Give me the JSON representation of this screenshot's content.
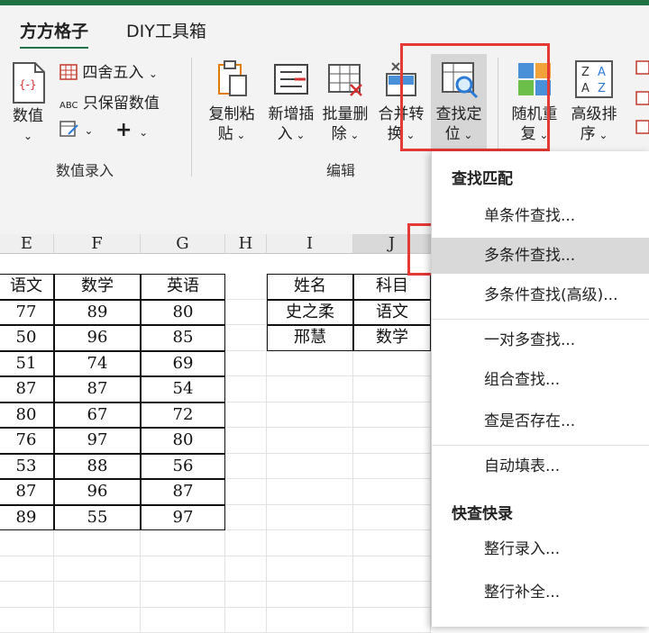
{
  "tabs": [
    {
      "label": "方方格子",
      "active": true
    },
    {
      "label": "DIY工具箱",
      "active": false
    }
  ],
  "ribbon": {
    "value_group": {
      "label": "数值录入",
      "value_button": {
        "line1": "数值",
        "line2": ""
      },
      "round_label": "四舍五入",
      "keep_label": "只保留数值",
      "abc_label": "ABC"
    },
    "edit_group": {
      "label": "编辑",
      "buttons": [
        {
          "line1": "复制粘",
          "line2": "贴"
        },
        {
          "line1": "新增插",
          "line2": "入"
        },
        {
          "line1": "批量删",
          "line2": "除"
        },
        {
          "line1": "合并转",
          "line2": "换"
        },
        {
          "line1": "查找定",
          "line2": "位"
        },
        {
          "line1": "随机重",
          "line2": "复"
        },
        {
          "line1": "高级排",
          "line2": "序"
        }
      ]
    },
    "sort_icon_letters": [
      "Z",
      "A",
      "A",
      "Z"
    ],
    "colors": {
      "accent": "#217346",
      "highlight_red": "#e53935"
    }
  },
  "sheet": {
    "col_headers": [
      "E",
      "F",
      "G",
      "H",
      "I",
      "J"
    ],
    "table_header": [
      "语文",
      "数学",
      "英语"
    ],
    "rows": [
      [
        "77",
        "89",
        "80"
      ],
      [
        "50",
        "96",
        "85"
      ],
      [
        "51",
        "74",
        "69"
      ],
      [
        "87",
        "87",
        "54"
      ],
      [
        "80",
        "67",
        "72"
      ],
      [
        "76",
        "97",
        "80"
      ],
      [
        "53",
        "88",
        "56"
      ],
      [
        "87",
        "96",
        "87"
      ],
      [
        "89",
        "55",
        "97"
      ]
    ],
    "lookup": {
      "header": [
        "姓名",
        "科目"
      ],
      "rows": [
        [
          "史之柔",
          "语文"
        ],
        [
          "邢慧",
          "数学"
        ]
      ]
    }
  },
  "menu": {
    "section1": "查找匹配",
    "items1": [
      "单条件查找...",
      "多条件查找...",
      "多条件查找(高级)...",
      "一对多查找...",
      "组合查找...",
      "查是否存在...",
      "自动填表..."
    ],
    "section2": "快查快录",
    "items2": [
      "整行录入...",
      "整行补全..."
    ]
  }
}
